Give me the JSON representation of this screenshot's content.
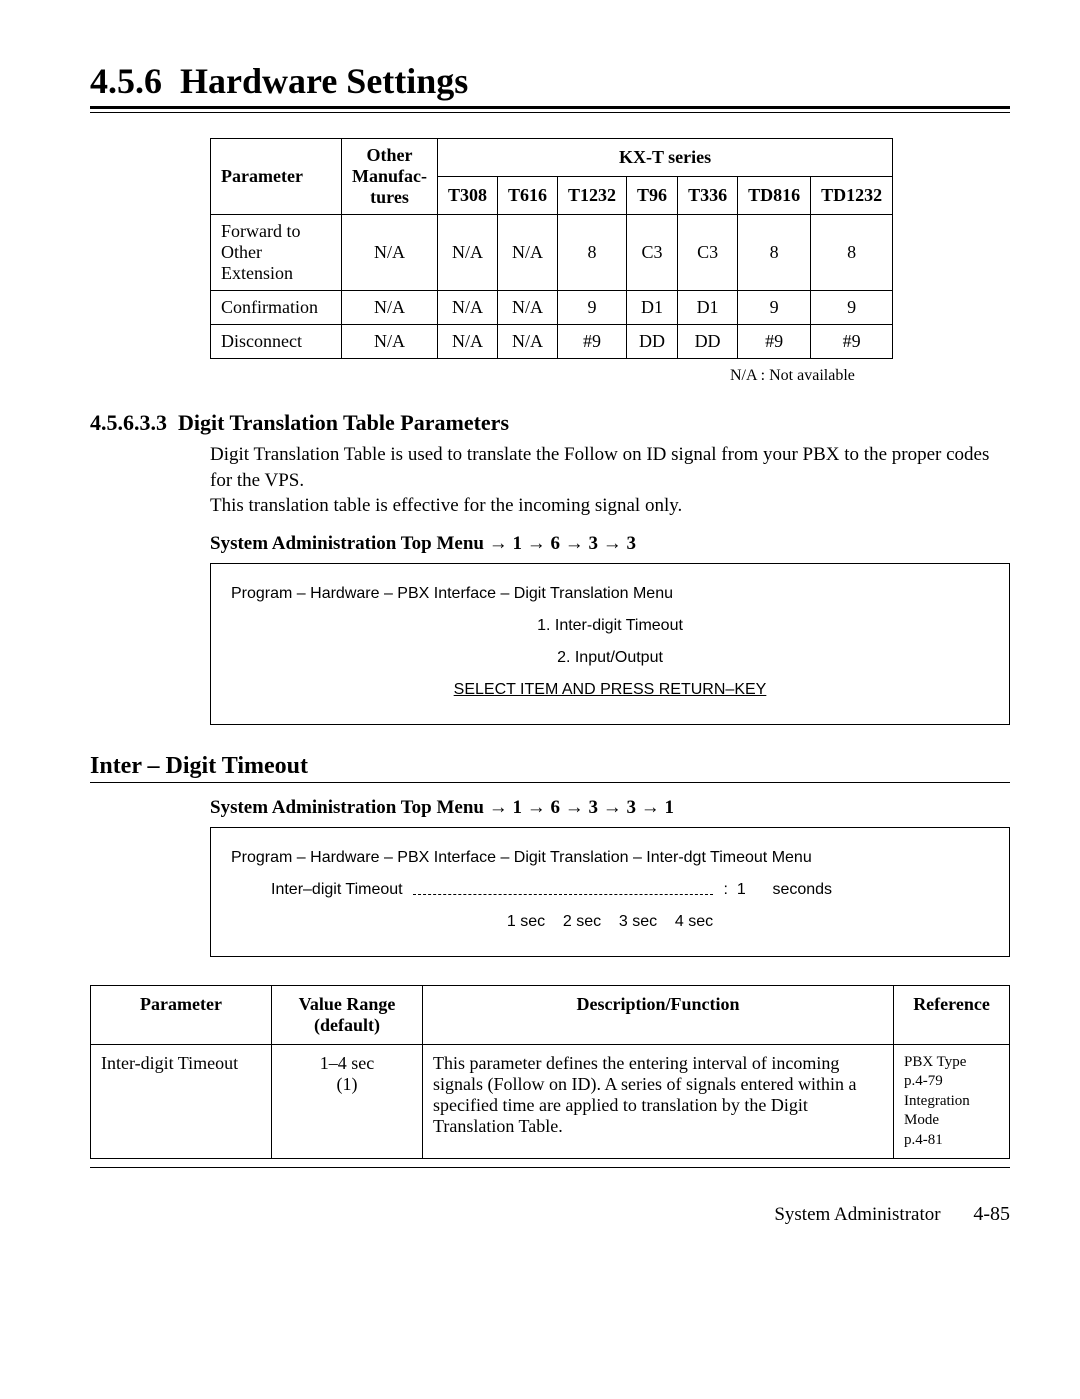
{
  "title_num": "4.5.6",
  "title_text": "Hardware Settings",
  "table1": {
    "head_parameter": "Parameter",
    "head_other": "Other\nManufac-tures",
    "head_other_l1": "Other",
    "head_other_l2": "Manufac-",
    "head_other_l3": "tures",
    "kx_group": "KX-T series",
    "cols": [
      "T308",
      "T616",
      "T1232",
      "T96",
      "T336",
      "TD816",
      "TD1232"
    ],
    "rows": [
      {
        "param": "Forward to Other Extension",
        "other": "N/A",
        "vals": [
          "N/A",
          "N/A",
          "8",
          "C3",
          "C3",
          "8",
          "8"
        ]
      },
      {
        "param": "Confirmation",
        "other": "N/A",
        "vals": [
          "N/A",
          "N/A",
          "9",
          "D1",
          "D1",
          "9",
          "9"
        ]
      },
      {
        "param": "Disconnect",
        "other": "N/A",
        "vals": [
          "N/A",
          "N/A",
          "#9",
          "DD",
          "DD",
          "#9",
          "#9"
        ]
      }
    ],
    "note": "N/A : Not available"
  },
  "section3": {
    "num": "4.5.6.3.3",
    "title": "Digit Translation Table Parameters",
    "p1": "Digit Translation Table is used to translate the Follow on ID signal from your PBX to the proper codes for the VPS.",
    "p2": "This translation table is effective for the incoming signal only.",
    "menu_path": "System Administration Top Menu → 1 → 6 → 3 → 3",
    "box": {
      "bread": "Program – Hardware – PBX Interface – Digit Translation Menu",
      "item1": "1.  Inter-digit Timeout",
      "item2": "2.  Input/Output",
      "prompt": "SELECT ITEM AND PRESS RETURN–KEY"
    }
  },
  "inter": {
    "h2": "Inter – Digit Timeout",
    "menu_path": "System Administration Top Menu → 1 → 6 → 3 → 3 → 1",
    "box": {
      "bread": "Program – Hardware – PBX Interface – Digit Translation – Inter-dgt Timeout Menu",
      "label": "Inter–digit Timeout",
      "value_sep": ":",
      "value": "1",
      "unit": "seconds",
      "opts": "1 sec    2 sec    3 sec    4 sec"
    },
    "table": {
      "h_param": "Parameter",
      "h_range": "Value Range (default)",
      "h_desc": "Description/Function",
      "h_ref": "Reference",
      "row": {
        "param": "Inter-digit Timeout",
        "range": "1–4 sec\n(1)",
        "range_l1": "1–4 sec",
        "range_l2": "(1)",
        "desc": "This parameter defines the entering interval of incoming signals (Follow on ID). A series of signals entered within a specified time are applied to translation by the Digit Translation Table.",
        "ref_l1": "PBX Type",
        "ref_l2": "p.4-79",
        "ref_l3": "Integration Mode",
        "ref_l4": "p.4-81"
      }
    }
  },
  "footer": {
    "label": "System Administrator",
    "page": "4-85"
  }
}
